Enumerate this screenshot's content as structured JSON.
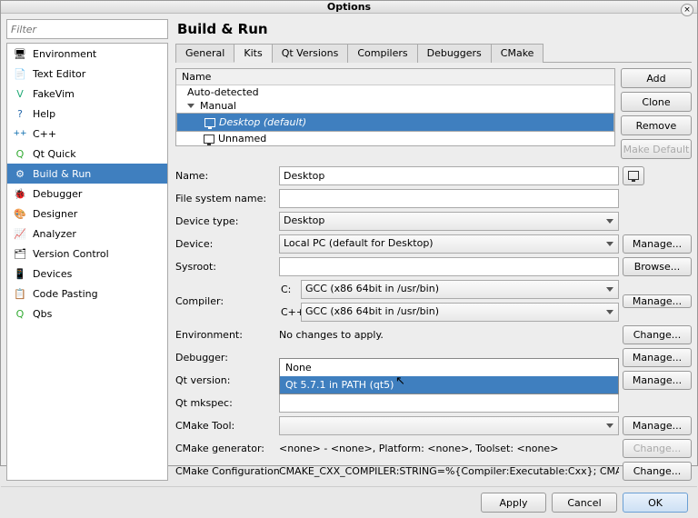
{
  "window_title": "Options",
  "filter_placeholder": "Filter",
  "categories": [
    {
      "label": "Environment"
    },
    {
      "label": "Text Editor"
    },
    {
      "label": "FakeVim"
    },
    {
      "label": "Help"
    },
    {
      "label": "C++"
    },
    {
      "label": "Qt Quick"
    },
    {
      "label": "Build & Run"
    },
    {
      "label": "Debugger"
    },
    {
      "label": "Designer"
    },
    {
      "label": "Analyzer"
    },
    {
      "label": "Version Control"
    },
    {
      "label": "Devices"
    },
    {
      "label": "Code Pasting"
    },
    {
      "label": "Qbs"
    }
  ],
  "heading": "Build & Run",
  "tabs": [
    "General",
    "Kits",
    "Qt Versions",
    "Compilers",
    "Debuggers",
    "CMake"
  ],
  "tree": {
    "header": "Name",
    "auto": "Auto-detected",
    "manual": "Manual",
    "kit_sel": "Desktop (default)",
    "kit2": "Unnamed"
  },
  "kitbtns": {
    "add": "Add",
    "clone": "Clone",
    "remove": "Remove",
    "mdef": "Make Default"
  },
  "form": {
    "name_l": "Name:",
    "name_v": "Desktop",
    "fsname_l": "File system name:",
    "fsname_v": "",
    "devtype_l": "Device type:",
    "devtype_v": "Desktop",
    "device_l": "Device:",
    "device_v": "Local PC (default for Desktop)",
    "sysroot_l": "Sysroot:",
    "sysroot_v": "",
    "compiler_l": "Compiler:",
    "c_l": "C:",
    "c_v": "GCC (x86 64bit in /usr/bin)",
    "cxx_l": "C++:",
    "cxx_v": "GCC (x86 64bit in /usr/bin)",
    "env_l": "Environment:",
    "env_v": "No changes to apply.",
    "dbg_l": "Debugger:",
    "qtver_l": "Qt version:",
    "qtver_opts": {
      "none": "None",
      "sel": "Qt 5.7.1 in PATH (qt5)"
    },
    "mkspec_l": "Qt mkspec:",
    "mkspec_v": "",
    "cmaketool_l": "CMake Tool:",
    "cmaketool_v": "",
    "cmakegen_l": "CMake generator:",
    "cmakegen_v": "<none> - <none>, Platform: <none>, Toolset: <none>",
    "cmakeconf_l": "CMake Configuration",
    "cmakeconf_v": "CMAKE_CXX_COMPILER:STRING=%{Compiler:Executable:Cxx}; CMAKE_C_C..."
  },
  "sidebtns": {
    "manage": "Manage...",
    "browse": "Browse...",
    "change": "Change..."
  },
  "footer": {
    "apply": "Apply",
    "cancel": "Cancel",
    "ok": "OK"
  }
}
